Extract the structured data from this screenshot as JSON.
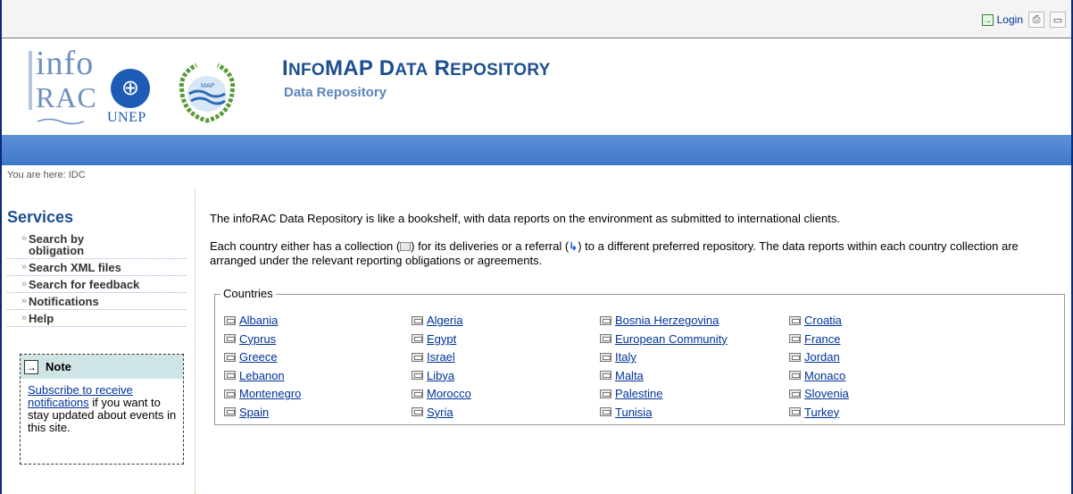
{
  "topbar": {
    "login_label": "Login",
    "print_icon": "print-icon",
    "fullscreen_icon": "fullscreen-icon"
  },
  "header": {
    "logo_info_l1": "info",
    "logo_info_l2": "RAC",
    "logo_unep_text": "UNEP",
    "logo_map_text": "MAP",
    "title_first": "I",
    "title_first_small": "NFO",
    "title_second": "MAP D",
    "title_second_small": "ATA",
    "title_third": " R",
    "title_third_small": "EPOSITORY",
    "subtitle": "Data Repository"
  },
  "breadcrumb": "You are here: IDC",
  "sidebar": {
    "services_title": "Services",
    "items": [
      {
        "label": "Search by obligation"
      },
      {
        "label": "Search XML files"
      },
      {
        "label": "Search for feedback"
      },
      {
        "label": "Notifications"
      },
      {
        "label": "Help"
      }
    ],
    "bullet": "»",
    "note": {
      "title": "Note",
      "link_text": "Subscribe to receive notifications",
      "rest_text": " if you want to stay updated about events in this site."
    }
  },
  "main": {
    "intro1": "The infoRAC Data Repository is like a bookshelf, with data reports on the environment as submitted to international clients.",
    "intro2_a": "Each country either has a collection (",
    "intro2_b": ") for its deliveries or a referral (",
    "intro2_c": ") to a different preferred repository. The data reports within each country collection are arranged under the relevant reporting obligations or agreements.",
    "countries_legend": "Countries",
    "countries": [
      "Albania",
      "Algeria",
      "Bosnia Herzegovina",
      "Croatia",
      "Cyprus",
      "Egypt",
      "European Community",
      "France",
      "Greece",
      "Israel",
      "Italy",
      "Jordan",
      "Lebanon",
      "Libya",
      "Malta",
      "Monaco",
      "Montenegro",
      "Morocco",
      "Palestine",
      "Slovenia",
      "Spain",
      "Syria",
      "Tunisia",
      "Turkey"
    ]
  },
  "colors": {
    "frame": "#0a2a7a",
    "title": "#1c4f8f",
    "bar": "#4a82cf",
    "link": "#003399"
  }
}
